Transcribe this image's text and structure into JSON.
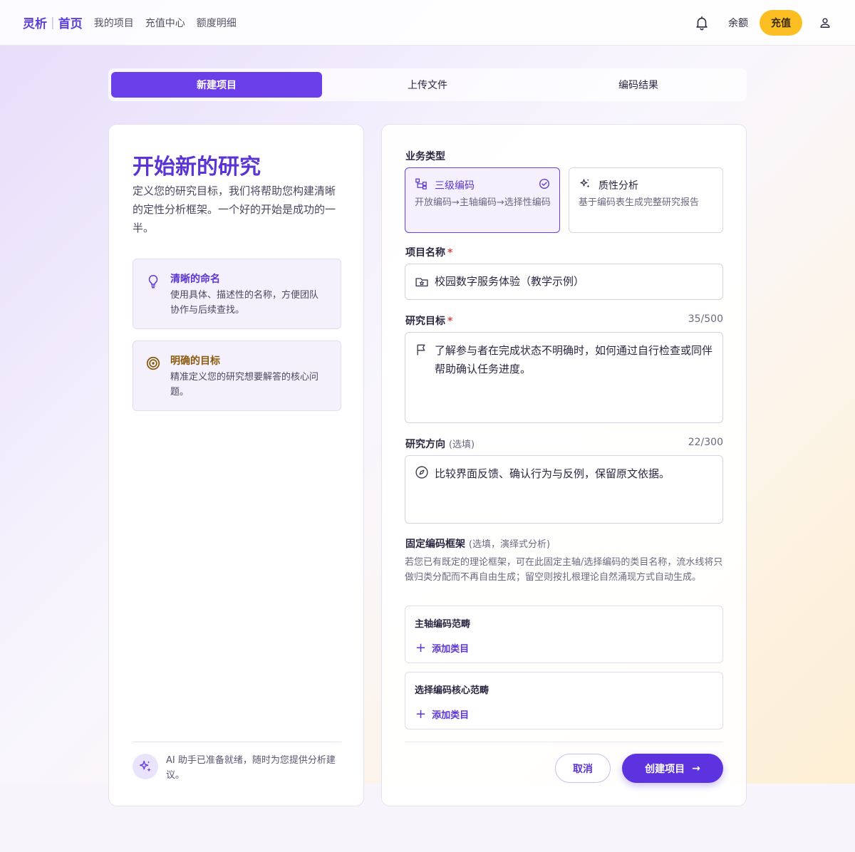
{
  "brand": {
    "name": "灵析",
    "home": "首页"
  },
  "nav": [
    "我的项目",
    "充值中心",
    "额度明细"
  ],
  "header": {
    "balance_label": "余额",
    "recharge_label": "充值"
  },
  "steps": [
    {
      "label": "新建项目",
      "active": true
    },
    {
      "label": "上传文件",
      "active": false
    },
    {
      "label": "编码结果",
      "active": false
    }
  ],
  "intro": {
    "title": "开始新的研究",
    "description": "定义您的研究目标，我们将帮助您构建清晰的定性分析框架。一个好的开始是成功的一半。",
    "tips": [
      {
        "title": "清晰的命名",
        "desc": "使用具体、描述性的名称，方便团队协作与后续查找。",
        "color": "#5b35d4"
      },
      {
        "title": "明确的目标",
        "desc": "精准定义您的研究想要解答的核心问题。",
        "color": "#8a5a0c"
      }
    ],
    "ai_note": "AI 助手已准备就绪，随时为您提供分析建议。"
  },
  "form": {
    "business_type_label": "业务类型",
    "types": [
      {
        "title": "三级编码",
        "desc": "开放编码→主轴编码→选择性编码",
        "selected": true
      },
      {
        "title": "质性分析",
        "desc": "基于编码表生成完整研究报告",
        "selected": false
      }
    ],
    "project_name": {
      "label": "项目名称",
      "required": "*",
      "value": "校园数字服务体验（教学示例）"
    },
    "research_goal": {
      "label": "研究目标",
      "required": "*",
      "counter": "35/500",
      "value": "了解参与者在完成状态不明确时，如何通过自行检查或同伴帮助确认任务进度。"
    },
    "research_direction": {
      "label": "研究方向",
      "optional": "(选填)",
      "counter": "22/300",
      "value": "比较界面反馈、确认行为与反例，保留原文依据。"
    },
    "framework": {
      "label": "固定编码框架",
      "optional": "(选填，演绎式分析)",
      "help": "若您已有既定的理论框架，可在此固定主轴/选择编码的类目名称，流水线将只做归类分配而不再自由生成；留空则按扎根理论自然涌现方式自动生成。",
      "boxes": [
        {
          "title": "主轴编码范畴",
          "add_label": "添加类目"
        },
        {
          "title": "选择编码核心范畴",
          "add_label": "添加类目"
        }
      ]
    },
    "cancel_label": "取消",
    "create_label": "创建项目"
  }
}
